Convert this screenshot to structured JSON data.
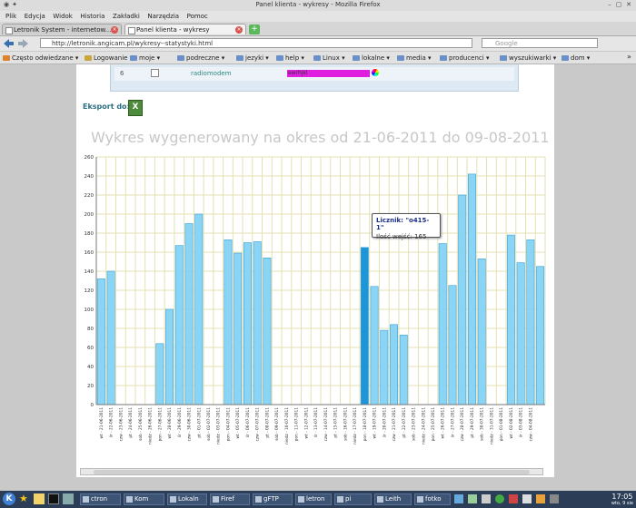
{
  "window": {
    "title": "Panel klienta - wykresy - Mozilla Firefox"
  },
  "menubar": [
    "Plik",
    "Edycja",
    "Widok",
    "Historia",
    "Zakładki",
    "Narzędzia",
    "Pomoc"
  ],
  "tabs": [
    {
      "label": "Letronik System - internetow..."
    },
    {
      "label": "Panel klienta - wykresy"
    }
  ],
  "nav": {
    "url": "http://letronik.angicam.pl/wykresy--statystyki.html",
    "search_placeholder": "Google"
  },
  "bookmarks": [
    "Często odwiedzane",
    "Logowanie",
    "moje",
    "podreczne",
    "jezyki",
    "help",
    "Linux",
    "lokalne",
    "media",
    "producenci",
    "wyszukiwarki",
    "dom"
  ],
  "prev_table": {
    "row_num": "6",
    "name": "radiomodem",
    "value": "ewrhjkl"
  },
  "export": {
    "label": "Eksport do:",
    "icon_text": "X"
  },
  "chart_title": "Wykres wygenerowany na okres od 21-06-2011 do 09-08-2011",
  "tooltip": {
    "title": "Licznik: \"o415-1\"",
    "line": "Ilość wejść: 165"
  },
  "colors": {
    "bar": "#8ad4f5",
    "bar_stroke": "#3ba0d8",
    "bar_highlight": "#1f95d9",
    "grid": "#e5e1b2",
    "chart_title": "#c7c7c7"
  },
  "chart_data": {
    "type": "bar",
    "title": "Wykres wygenerowany na okres od 21-06-2011 do 09-08-2011",
    "ylim": [
      0,
      260
    ],
    "yticks": [
      0,
      20,
      40,
      60,
      80,
      100,
      120,
      140,
      160,
      180,
      200,
      220,
      240,
      260
    ],
    "categories": [
      "wt - 21-06-2011",
      "śr - 22-06-2011",
      "czw - 23-06-2011",
      "pt - 24-06-2011",
      "sob - 25-06-2011",
      "niedz - 26-06-2011",
      "pon - 27-06-2011",
      "wt - 28-06-2011",
      "śr - 29-06-2011",
      "czw - 30-06-2011",
      "pt - 01-07-2011",
      "sob - 02-07-2011",
      "niedz - 03-07-2011",
      "pon - 04-07-2011",
      "wt - 05-07-2011",
      "śr - 06-07-2011",
      "czw - 07-07-2011",
      "pt - 08-07-2011",
      "sob - 09-07-2011",
      "niedz - 10-07-2011",
      "pon - 11-07-2011",
      "wt - 12-07-2011",
      "śr - 13-07-2011",
      "czw - 14-07-2011",
      "pt - 15-07-2011",
      "sob - 16-07-2011",
      "niedz - 17-07-2011",
      "pon - 18-07-2011",
      "wt - 19-07-2011",
      "śr - 20-07-2011",
      "czw - 21-07-2011",
      "pt - 22-07-2011",
      "sob - 23-07-2011",
      "niedz - 24-07-2011",
      "pon - 25-07-2011",
      "wt - 26-07-2011",
      "śr - 27-07-2011",
      "czw - 28-07-2011",
      "pt - 29-07-2011",
      "sob - 30-07-2011",
      "niedz - 31-07-2011",
      "pon - 01-08-2011",
      "wt - 02-08-2011",
      "śr - 03-08-2011",
      "czw - 04-08-2011"
    ],
    "values": [
      132,
      140,
      0,
      0,
      0,
      0,
      64,
      100,
      167,
      190,
      200,
      0,
      0,
      173,
      159,
      170,
      171,
      154,
      0,
      0,
      0,
      0,
      0,
      0,
      0,
      0,
      0,
      165,
      124,
      78,
      84,
      73,
      0,
      0,
      0,
      169,
      125,
      220,
      242,
      153,
      0,
      0,
      178,
      149,
      173,
      145
    ],
    "highlight_index": 27
  },
  "taskbar": {
    "items": [
      "ctron",
      "Kom",
      "Lokaln",
      "Firef",
      "gFTP",
      "letron",
      "pi",
      "Leith",
      "fotko"
    ],
    "clock_time": "17:05",
    "clock_date": "wto, 9 sie"
  }
}
